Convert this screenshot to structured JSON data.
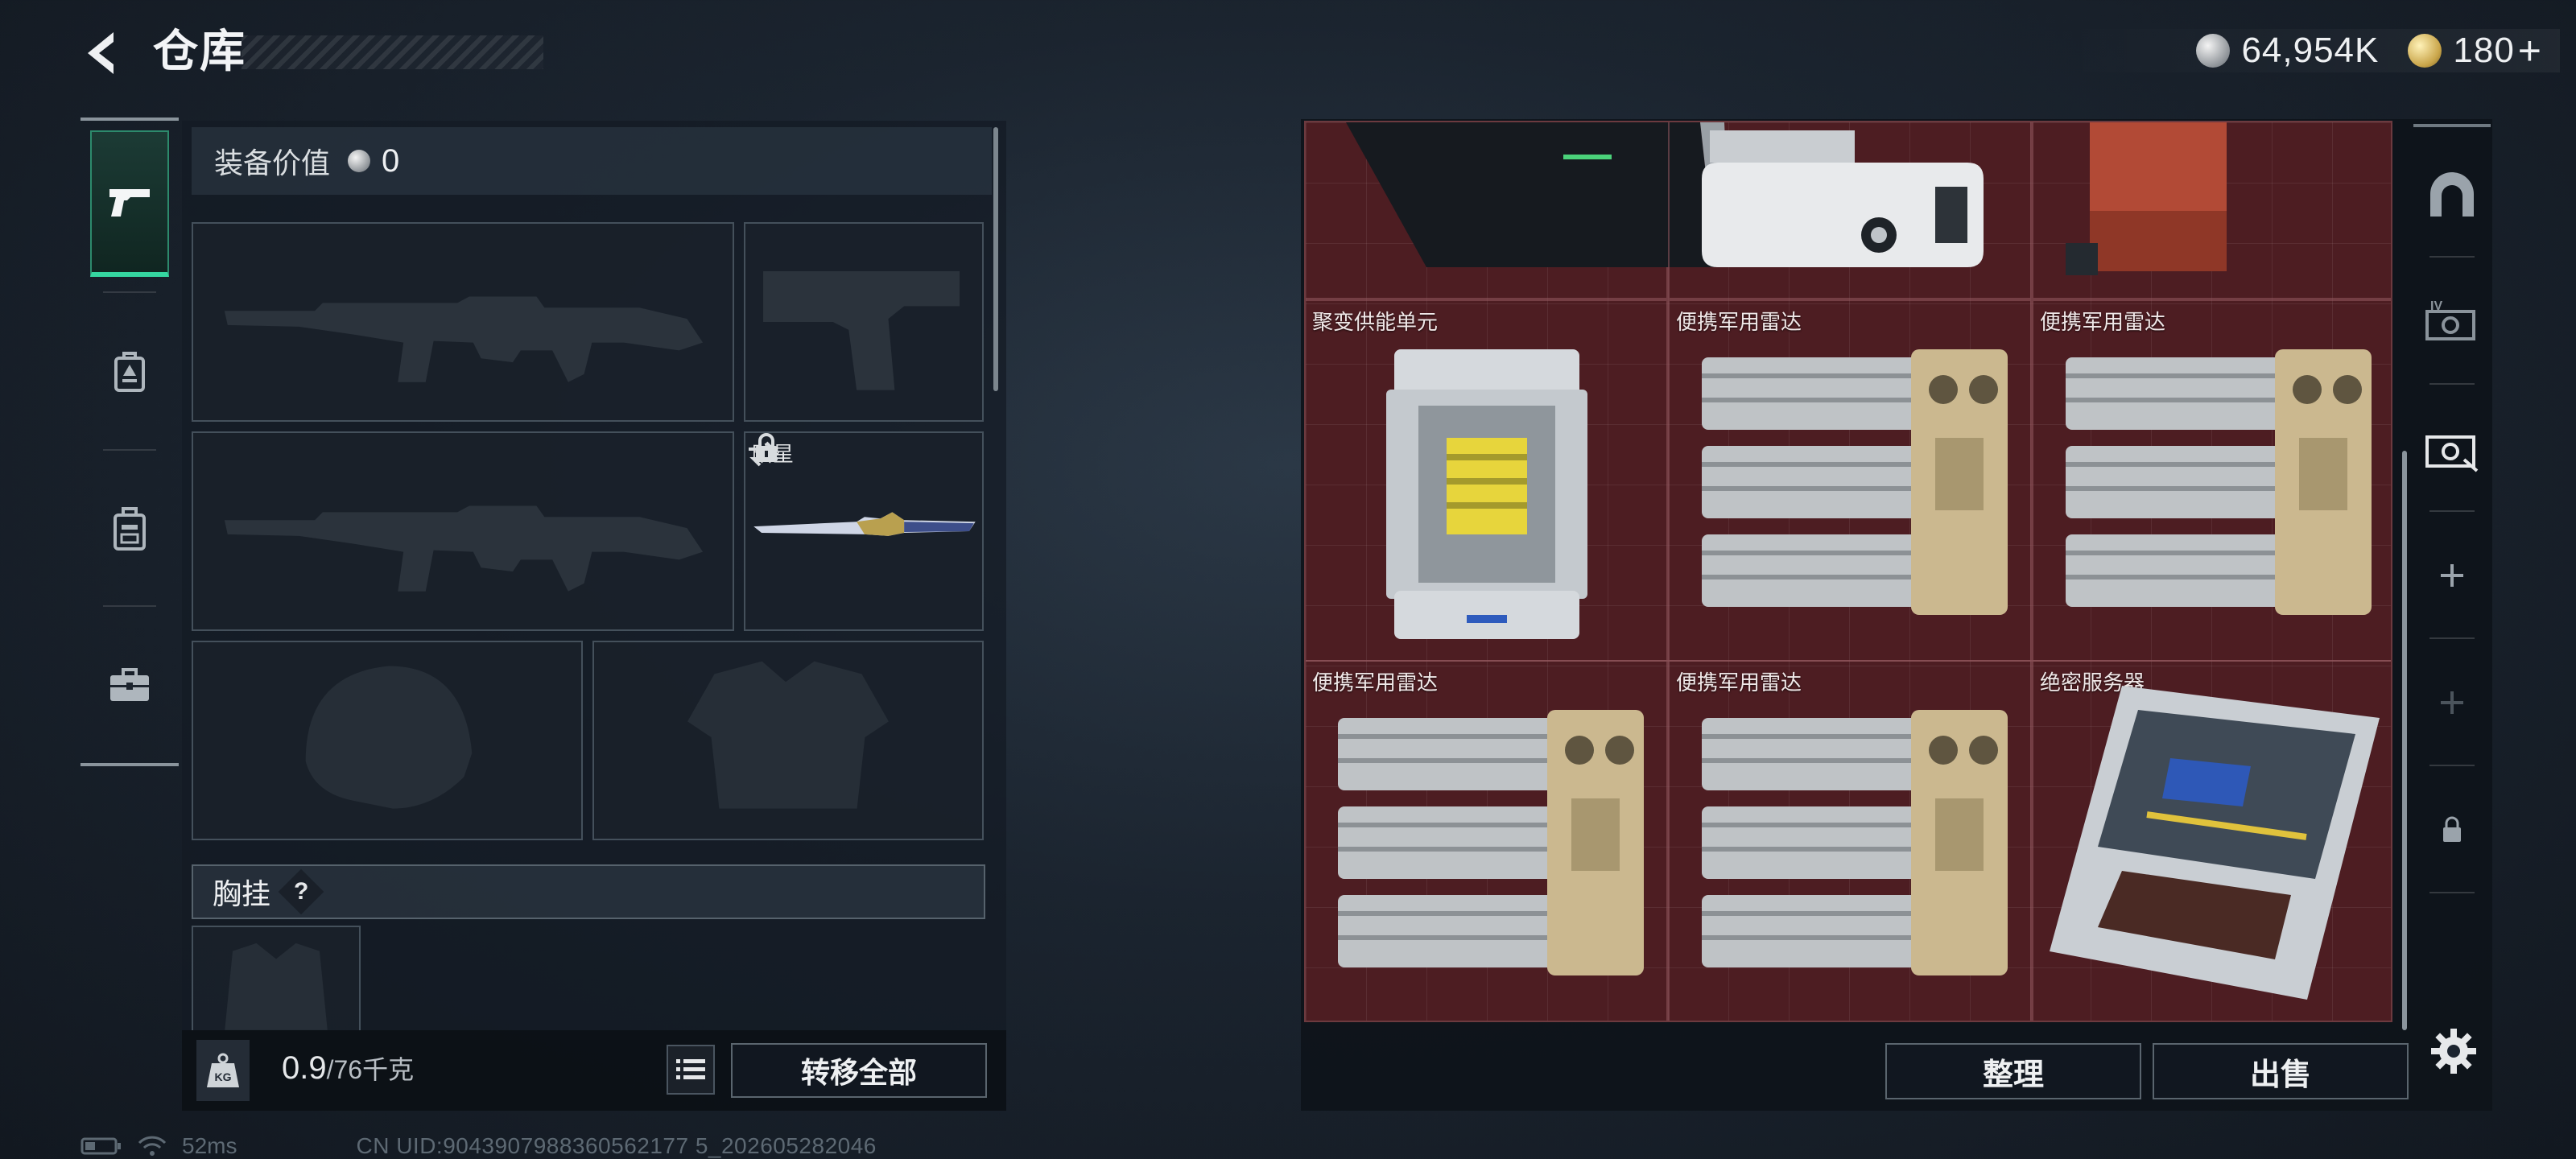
{
  "header": {
    "title": "仓库"
  },
  "currency": {
    "silver_value": "64,954K",
    "gold_value": "180",
    "gold_suffix": "+"
  },
  "left_tabs": [
    {
      "icon": "pistol-icon",
      "selected": true
    },
    {
      "icon": "armor-badge-icon",
      "selected": false
    },
    {
      "icon": "backpack-icon",
      "selected": false
    },
    {
      "icon": "briefcase-icon",
      "selected": false
    }
  ],
  "equipment": {
    "value_label": "装备价值",
    "value_amount": "0",
    "knife_slot_label": "暗星",
    "chest_rig_label": "胸挂",
    "chest_rig_help": "?"
  },
  "footer": {
    "weight_current": "0.9",
    "weight_max": "/76千克",
    "transfer_all": "转移全部",
    "sort": "整理",
    "sell": "出售"
  },
  "stash": {
    "items": [
      {
        "name": "",
        "icon": "crate-icon"
      },
      {
        "name": "",
        "icon": "device-icon"
      },
      {
        "name": "",
        "icon": "red-box-icon"
      },
      {
        "name": "聚变供能单元",
        "icon": "fusion-power-unit-icon"
      },
      {
        "name": "便携军用雷达",
        "icon": "portable-radar-icon"
      },
      {
        "name": "便携军用雷达",
        "icon": "portable-radar-icon"
      },
      {
        "name": "便携军用雷达",
        "icon": "portable-radar-icon"
      },
      {
        "name": "便携军用雷达",
        "icon": "portable-radar-icon"
      },
      {
        "name": "绝密服务器",
        "icon": "classified-server-icon"
      }
    ]
  },
  "right_tabs": [
    {
      "icon": "home-icon"
    },
    {
      "icon": "stash-tier-4-icon"
    },
    {
      "icon": "stash-active-icon"
    },
    {
      "icon": "plus-icon"
    },
    {
      "icon": "plus-dim-icon"
    },
    {
      "icon": "lock-icon"
    }
  ],
  "status": {
    "ping": "52ms",
    "uid": "CN UID:9043907988360562177 5_202605282046"
  },
  "colors": {
    "accent": "#35d6a0",
    "stash_bg": "#4d1d22",
    "panel_bg": "#141b24"
  }
}
